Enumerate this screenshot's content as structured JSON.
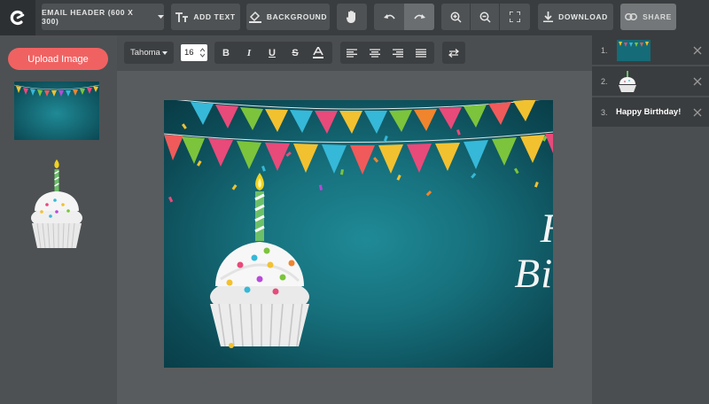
{
  "toolbar": {
    "template_label": "EMAIL HEADER (600 X 300)",
    "add_text_label": "ADD TEXT",
    "background_label": "BACKGROUND",
    "download_label": "DOWNLOAD",
    "share_label": "SHARE"
  },
  "sidebar": {
    "upload_label": "Upload Image"
  },
  "format": {
    "font_family": "Tahoma",
    "font_size": "16"
  },
  "canvas": {
    "line1": "Happy",
    "line2": "Birthday!"
  },
  "layers": [
    {
      "num": "1.",
      "type": "image",
      "icon": "banner-thumbnail"
    },
    {
      "num": "2.",
      "type": "image",
      "icon": "cupcake-thumbnail"
    },
    {
      "num": "3.",
      "type": "text",
      "label": "Happy Birthday!"
    }
  ],
  "colors": {
    "accent": "#f06262",
    "toolbar": "#3a3d3f",
    "canvas_bg": "#16707c"
  }
}
